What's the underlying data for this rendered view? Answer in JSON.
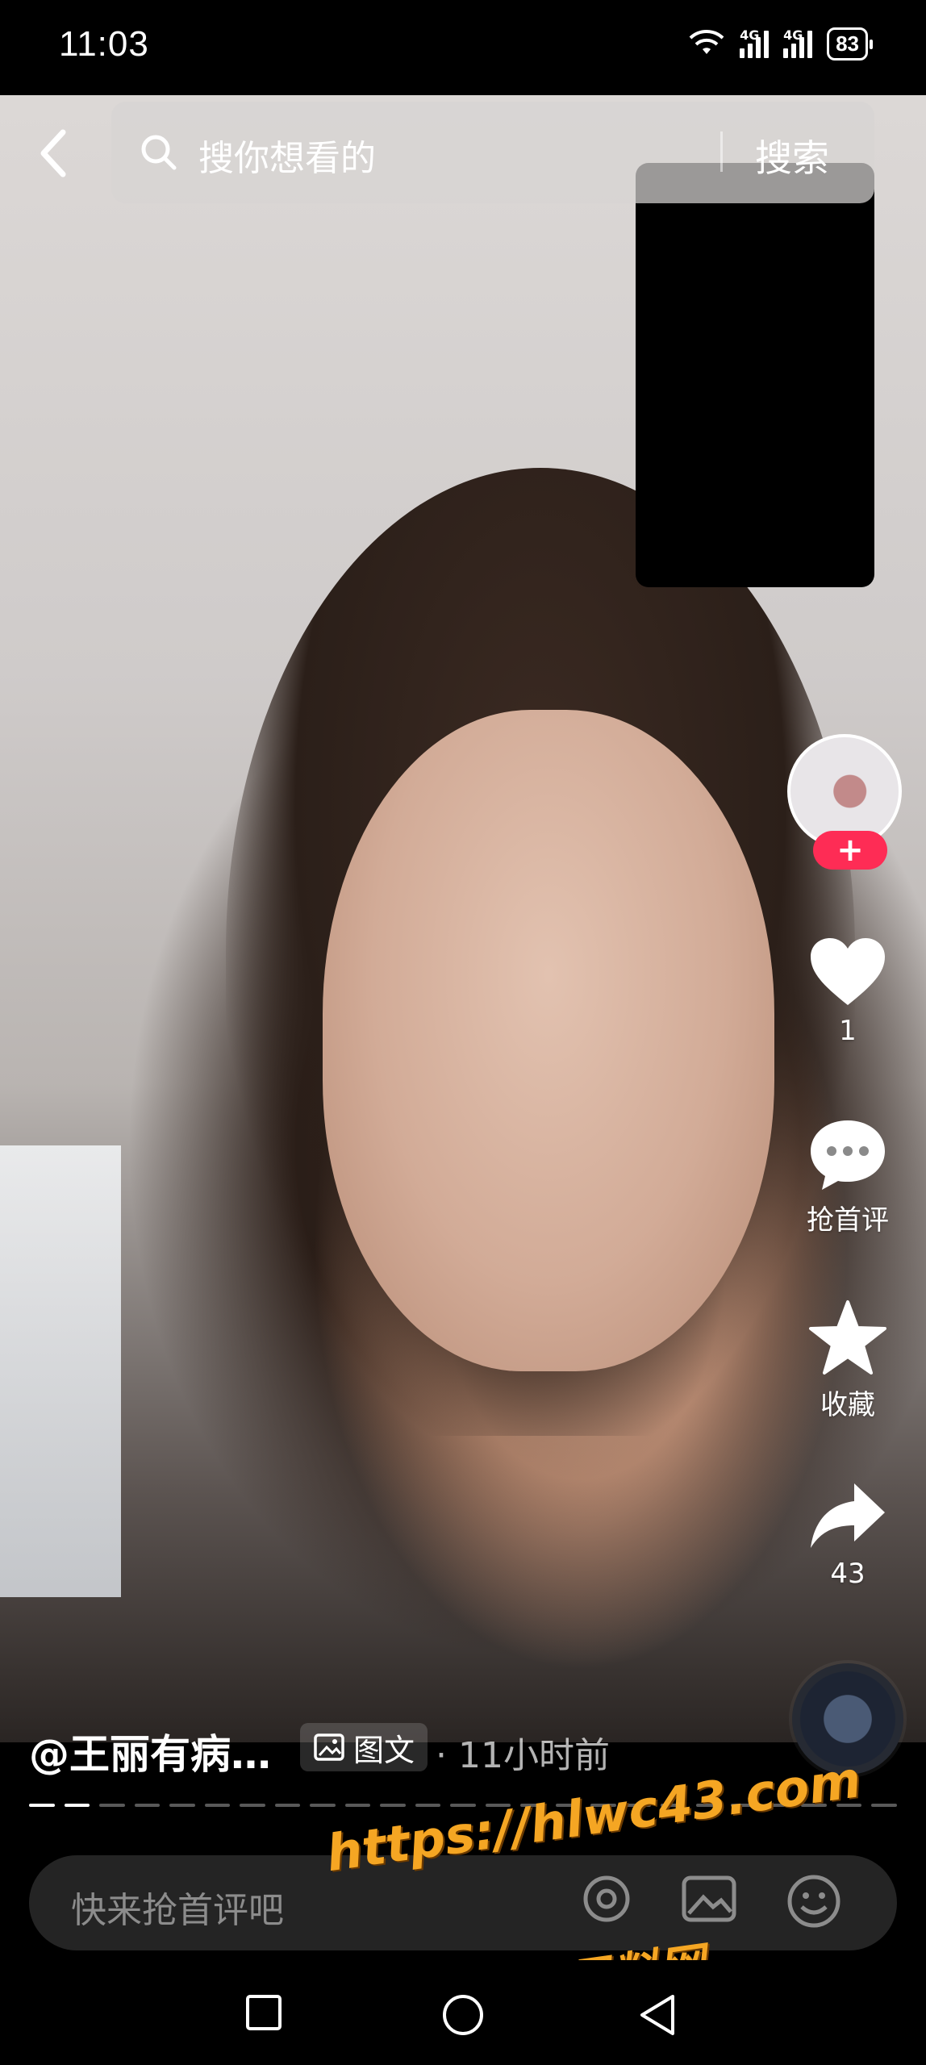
{
  "status_bar": {
    "time": "11:03",
    "network_1": "4G",
    "network_2": "4G",
    "battery": "83"
  },
  "search": {
    "placeholder": "搜你想看的",
    "button_label": "搜索"
  },
  "actions": {
    "like_count": "1",
    "comment_label": "抢首评",
    "favorite_label": "收藏",
    "share_count": "43",
    "follow_symbol": "+"
  },
  "post": {
    "author": "@王丽有病…",
    "type_badge": "图文",
    "time": "· 11小时前",
    "progress_total_segments": 25,
    "progress_active_segments": 2
  },
  "comment": {
    "placeholder": "快来抢首评吧"
  },
  "watermark": {
    "url": "https://hlwc43.com",
    "site": "黑料网",
    "color": "#f5a623"
  },
  "icons": [
    "back-icon",
    "search-icon",
    "wifi-icon",
    "signal-icon",
    "battery-icon",
    "heart-icon",
    "comment-icon",
    "star-icon",
    "share-icon",
    "music-disc-icon",
    "image-icon",
    "at-icon",
    "emoji-icon",
    "recent-apps-icon",
    "home-icon",
    "back-nav-icon"
  ],
  "colors": {
    "accent": "#fe2c55",
    "background": "#000000"
  }
}
